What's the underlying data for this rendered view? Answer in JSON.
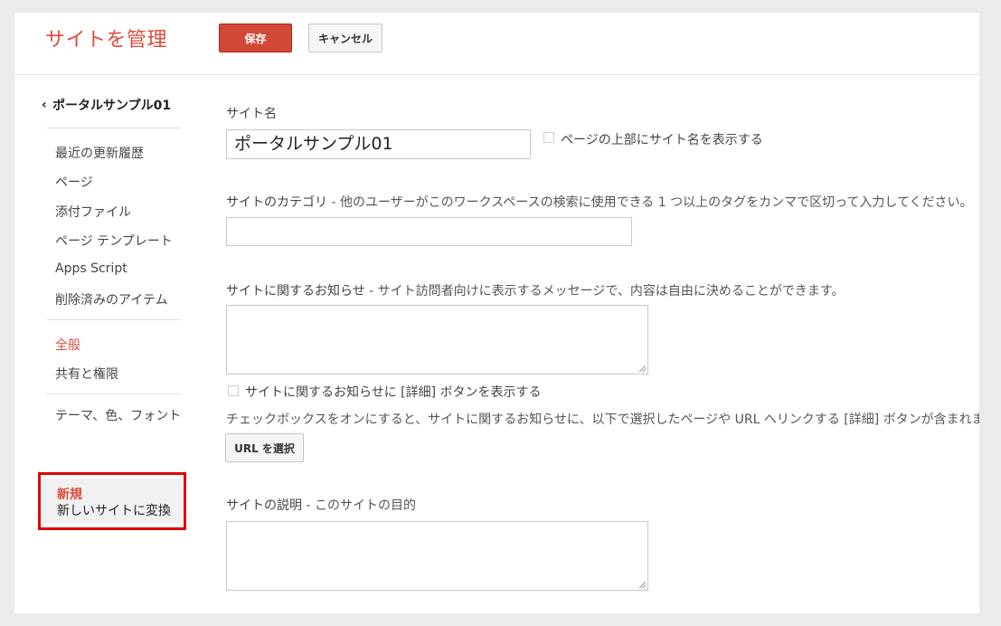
{
  "header": {
    "title": "サイトを管理",
    "save_label": "保存",
    "cancel_label": "キャンセル"
  },
  "sidebar": {
    "site_name": "ポータルサンプル01",
    "group1": [
      "最近の更新履歴",
      "ページ",
      "添付ファイル",
      "ページ テンプレート",
      "Apps Script",
      "削除済みのアイテム"
    ],
    "group2": [
      "全般",
      "共有と権限"
    ],
    "group3": [
      "テーマ、色、フォント"
    ],
    "convert": {
      "badge": "新規",
      "label": "新しいサイトに変換"
    }
  },
  "main": {
    "site_name_label": "サイト名",
    "site_name_value": "ポータルサンプル01",
    "show_site_name_label": "ページの上部にサイト名を表示する",
    "category_label": "サイトのカテゴリ",
    "category_desc": " - 他のユーザーがこのワークスペースの検索に使用できる 1 つ以上のタグをカンマで区切って入力してください。",
    "announcement_label": "サイトに関するお知らせ",
    "announcement_desc": " - サイト訪問者向けに表示するメッセージで、内容は自由に決めることができます。",
    "show_details_button_label": "サイトに関するお知らせに [詳細] ボタンを表示する",
    "details_note": "チェックボックスをオンにすると、サイトに関するお知らせに、以下で選択したページや URL へリンクする [詳細] ボタンが含まれます。",
    "select_url_label": "URL を選択",
    "description_label": "サイトの説明",
    "description_desc": " - このサイトの目的"
  },
  "colors": {
    "accent": "#dd4b39",
    "save_button": "#d14836",
    "highlight_border": "#e00000"
  }
}
